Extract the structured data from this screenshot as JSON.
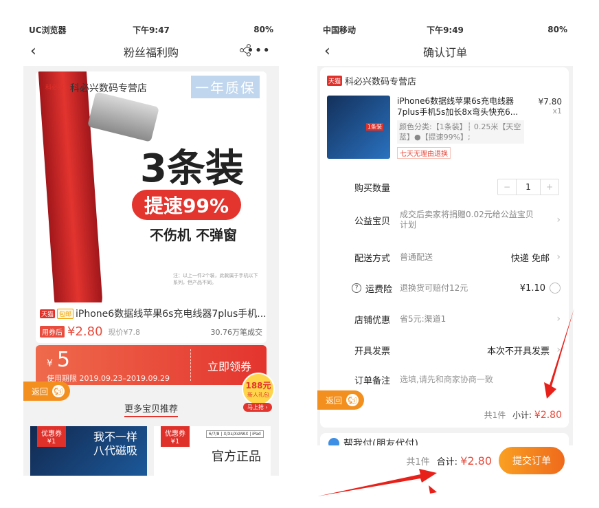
{
  "left": {
    "status": {
      "carrier": "UC浏览器",
      "time": "下午9:47",
      "battery": "80%"
    },
    "nav": {
      "title": "粉丝福利购"
    },
    "banner": {
      "shop": "科必兴数码专营店",
      "brand_mini": "科必兴",
      "quality": "一年质保",
      "headline": "3条装",
      "speed": "提速99%",
      "sub": "不伤机 不弹窗",
      "fine_print": "注：以上一件2个装，此款属于手机以下系列，但产品不同。"
    },
    "product": {
      "tag_tmall": "天猫",
      "tag_post": "包邮",
      "title": "iPhone6数据线苹果6s充电线器7plus手机...",
      "coupon_label": "用券后",
      "price": "¥2.80",
      "orig": "现价¥7.8",
      "sold": "30.76万笔成交"
    },
    "coupon": {
      "currency": "¥",
      "amount": "5",
      "period": "使用期限 2019.09.23–2019.09.29",
      "get": "立即领券"
    },
    "back": "返回",
    "gift": {
      "amount": "188元",
      "sub": "新人礼包",
      "grab": "马上抢 ›"
    },
    "more_title": "更多宝贝推荐",
    "rec": [
      {
        "coupon": "优惠券",
        "val": "¥1",
        "text1": "我不一样",
        "text2": "八代磁吸"
      },
      {
        "coupon": "优惠券",
        "val": "¥1",
        "models": "6/7/8 | X/Xs/XsMAX | iPad",
        "text": "官方正品"
      }
    ]
  },
  "right": {
    "status": {
      "carrier": "中国移动",
      "time": "下午9:49",
      "battery": "80%"
    },
    "nav": {
      "title": "确认订单"
    },
    "shop": {
      "tag": "天猫",
      "name": "科必兴数码专营店"
    },
    "item": {
      "name": "iPhone6数据线苹果6s充电线器7plus手机5s加长8x弯头快充6...",
      "spec": "颜色分类:【1条装】┆ 0.25米【天空蓝】●【提速99%】;",
      "return": "七天无理由退换",
      "price": "¥7.80",
      "qty": "x1",
      "thumb_label": "1条装"
    },
    "rows": {
      "buy_qty_label": "购买数量",
      "buy_qty_value": "1",
      "minus": "−",
      "plus": "+",
      "charity_label": "公益宝贝",
      "charity_value": "成交后卖家将捐赠0.02元给公益宝贝计划",
      "delivery_label": "配送方式",
      "delivery_value": "普通配送",
      "delivery_right": "快递 免邮",
      "insurance_label": "运费险",
      "insurance_value": "退换货可赔付12元",
      "insurance_right": "¥1.10",
      "discount_label": "店铺优惠",
      "discount_value": "省5元:渠道1",
      "invoice_label": "开具发票",
      "invoice_right": "本次不开具发票",
      "note_label": "订单备注",
      "note_placeholder": "选填,请先和商家协商一致"
    },
    "subtotal": {
      "count": "共1件",
      "label": "小计:",
      "price": "¥2.80"
    },
    "back": "返回",
    "pay": "帮我付(朋友代付)",
    "bottom": {
      "count": "共1件",
      "label": "合计:",
      "total": "¥2.80",
      "submit": "提交订单"
    }
  }
}
